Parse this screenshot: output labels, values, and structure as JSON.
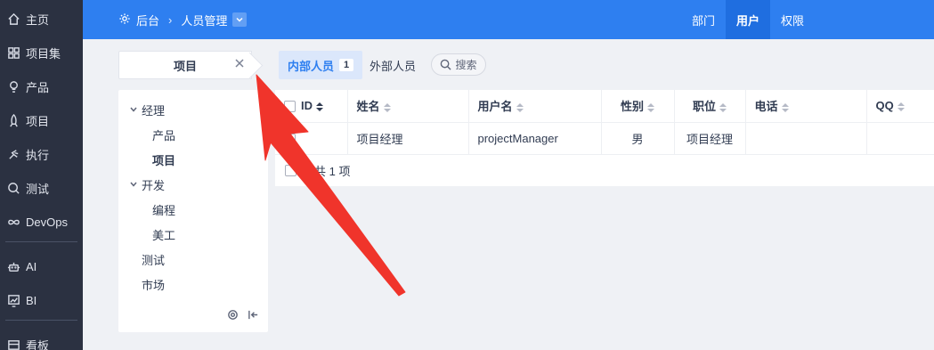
{
  "sidebar": {
    "items": [
      {
        "label": "主页",
        "icon": "home-icon"
      },
      {
        "label": "项目集",
        "icon": "grid-icon"
      },
      {
        "label": "产品",
        "icon": "lightbulb-icon"
      },
      {
        "label": "项目",
        "icon": "rocket-icon"
      },
      {
        "label": "执行",
        "icon": "run-icon"
      },
      {
        "label": "测试",
        "icon": "test-search-icon"
      },
      {
        "label": "DevOps",
        "icon": "infinity-icon"
      },
      {
        "label": "AI",
        "icon": "robot-icon"
      },
      {
        "label": "BI",
        "icon": "chart-icon"
      },
      {
        "label": "看板",
        "icon": "board-icon"
      }
    ]
  },
  "header": {
    "breadcrumb_root": "后台",
    "breadcrumb_current": "人员管理",
    "nav": [
      "部门",
      "用户",
      "权限"
    ],
    "nav_active": "用户"
  },
  "project_select": {
    "label": "项目"
  },
  "tabs": {
    "inner_label": "内部人员",
    "inner_count": "1",
    "outer_label": "外部人员",
    "search_label": "搜索"
  },
  "tree": {
    "items": [
      {
        "label": "经理",
        "level": 0,
        "expanded": true
      },
      {
        "label": "产品",
        "level": 1
      },
      {
        "label": "项目",
        "level": 1,
        "selected": true
      },
      {
        "label": "开发",
        "level": 0,
        "expanded": true
      },
      {
        "label": "编程",
        "level": 1
      },
      {
        "label": "美工",
        "level": 1
      },
      {
        "label": "测试",
        "level": 0
      },
      {
        "label": "市场",
        "level": 0
      }
    ]
  },
  "table": {
    "headers": [
      "ID",
      "姓名",
      "用户名",
      "性别",
      "职位",
      "电话",
      "QQ"
    ],
    "rows": [
      {
        "id": "",
        "name": "项目经理",
        "username": "projectManager",
        "gender": "男",
        "position": "项目经理",
        "phone": "",
        "qq": ""
      }
    ],
    "footer_text": "共 1 项"
  },
  "colors": {
    "accent": "#2e7ff0",
    "sidebar_bg": "#2b3141",
    "arrow": "#f0342b"
  }
}
